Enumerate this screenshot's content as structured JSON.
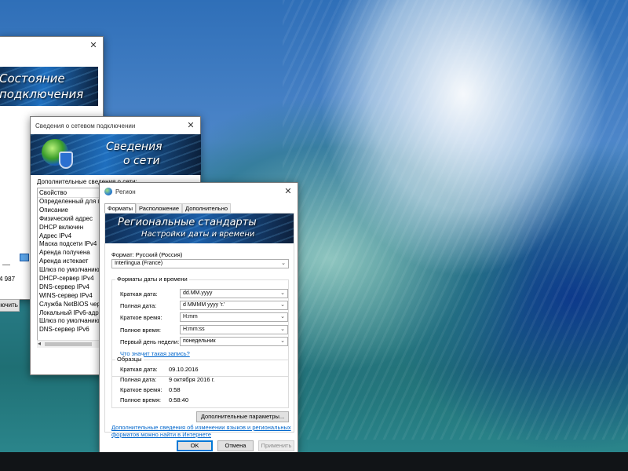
{
  "connection_status_window": {
    "banner_line1": "Состояние",
    "banner_line2": "подключения",
    "bytes": "4 987",
    "button_partial": "лючить"
  },
  "network_details_window": {
    "title": "Сведения о сетевом подключении",
    "banner_line1": "Сведения",
    "banner_line2": "о сети",
    "list_label": "Дополнительные сведения о сети:",
    "column_header": "Свойство",
    "properties": [
      "Определенный для п...",
      "Описание",
      "Физический адрес",
      "DHCP включен",
      "Адрес IPv4",
      "Маска подсети IPv4",
      "Аренда получена",
      "Аренда истекает",
      "Шлюз по умолчанию I...",
      "DHCP-сервер IPv4",
      "DNS-сервер IPv4",
      "WINS-сервер IPv4",
      "Служба NetBIOS чере...",
      "Локальный IPv6-адр...",
      "Шлюз по умолчанию I...",
      "DNS-сервер IPv6"
    ]
  },
  "region_window": {
    "title": "Регион",
    "tabs": [
      "Форматы",
      "Расположение",
      "Дополнительно"
    ],
    "banner_line1": "Региональные стандарты",
    "banner_line2": "Настройки даты и времени",
    "format_label": "Формат: Русский (Россия)",
    "format_value": "Interlingua (France)",
    "date_time_group_title": "Форматы даты и времени",
    "fields": [
      {
        "label": "Краткая дата:",
        "value": "dd.MM.yyyy"
      },
      {
        "label": "Полная дата:",
        "value": "d MMMM yyyy 'г.'"
      },
      {
        "label": "Краткое время:",
        "value": "H:mm"
      },
      {
        "label": "Полное время:",
        "value": "H:mm:ss"
      },
      {
        "label": "Первый день недели:",
        "value": "понедельник"
      }
    ],
    "what_means_link": "Что значит такая запись?",
    "samples_group_title": "Образцы",
    "samples": [
      {
        "label": "Краткая дата:",
        "value": "09.10.2016"
      },
      {
        "label": "Полная дата:",
        "value": "9 октября 2016 г."
      },
      {
        "label": "Краткое время:",
        "value": "0:58"
      },
      {
        "label": "Полное время:",
        "value": "0:58:40"
      }
    ],
    "additional_params_button": "Дополнительные параметры...",
    "info_link_line1": "Дополнительные сведения об изменении языков и региональных",
    "info_link_line2": "форматов можно найти в Интернете",
    "ok_button": "OK",
    "cancel_button": "Отмена",
    "apply_button": "Применить"
  }
}
